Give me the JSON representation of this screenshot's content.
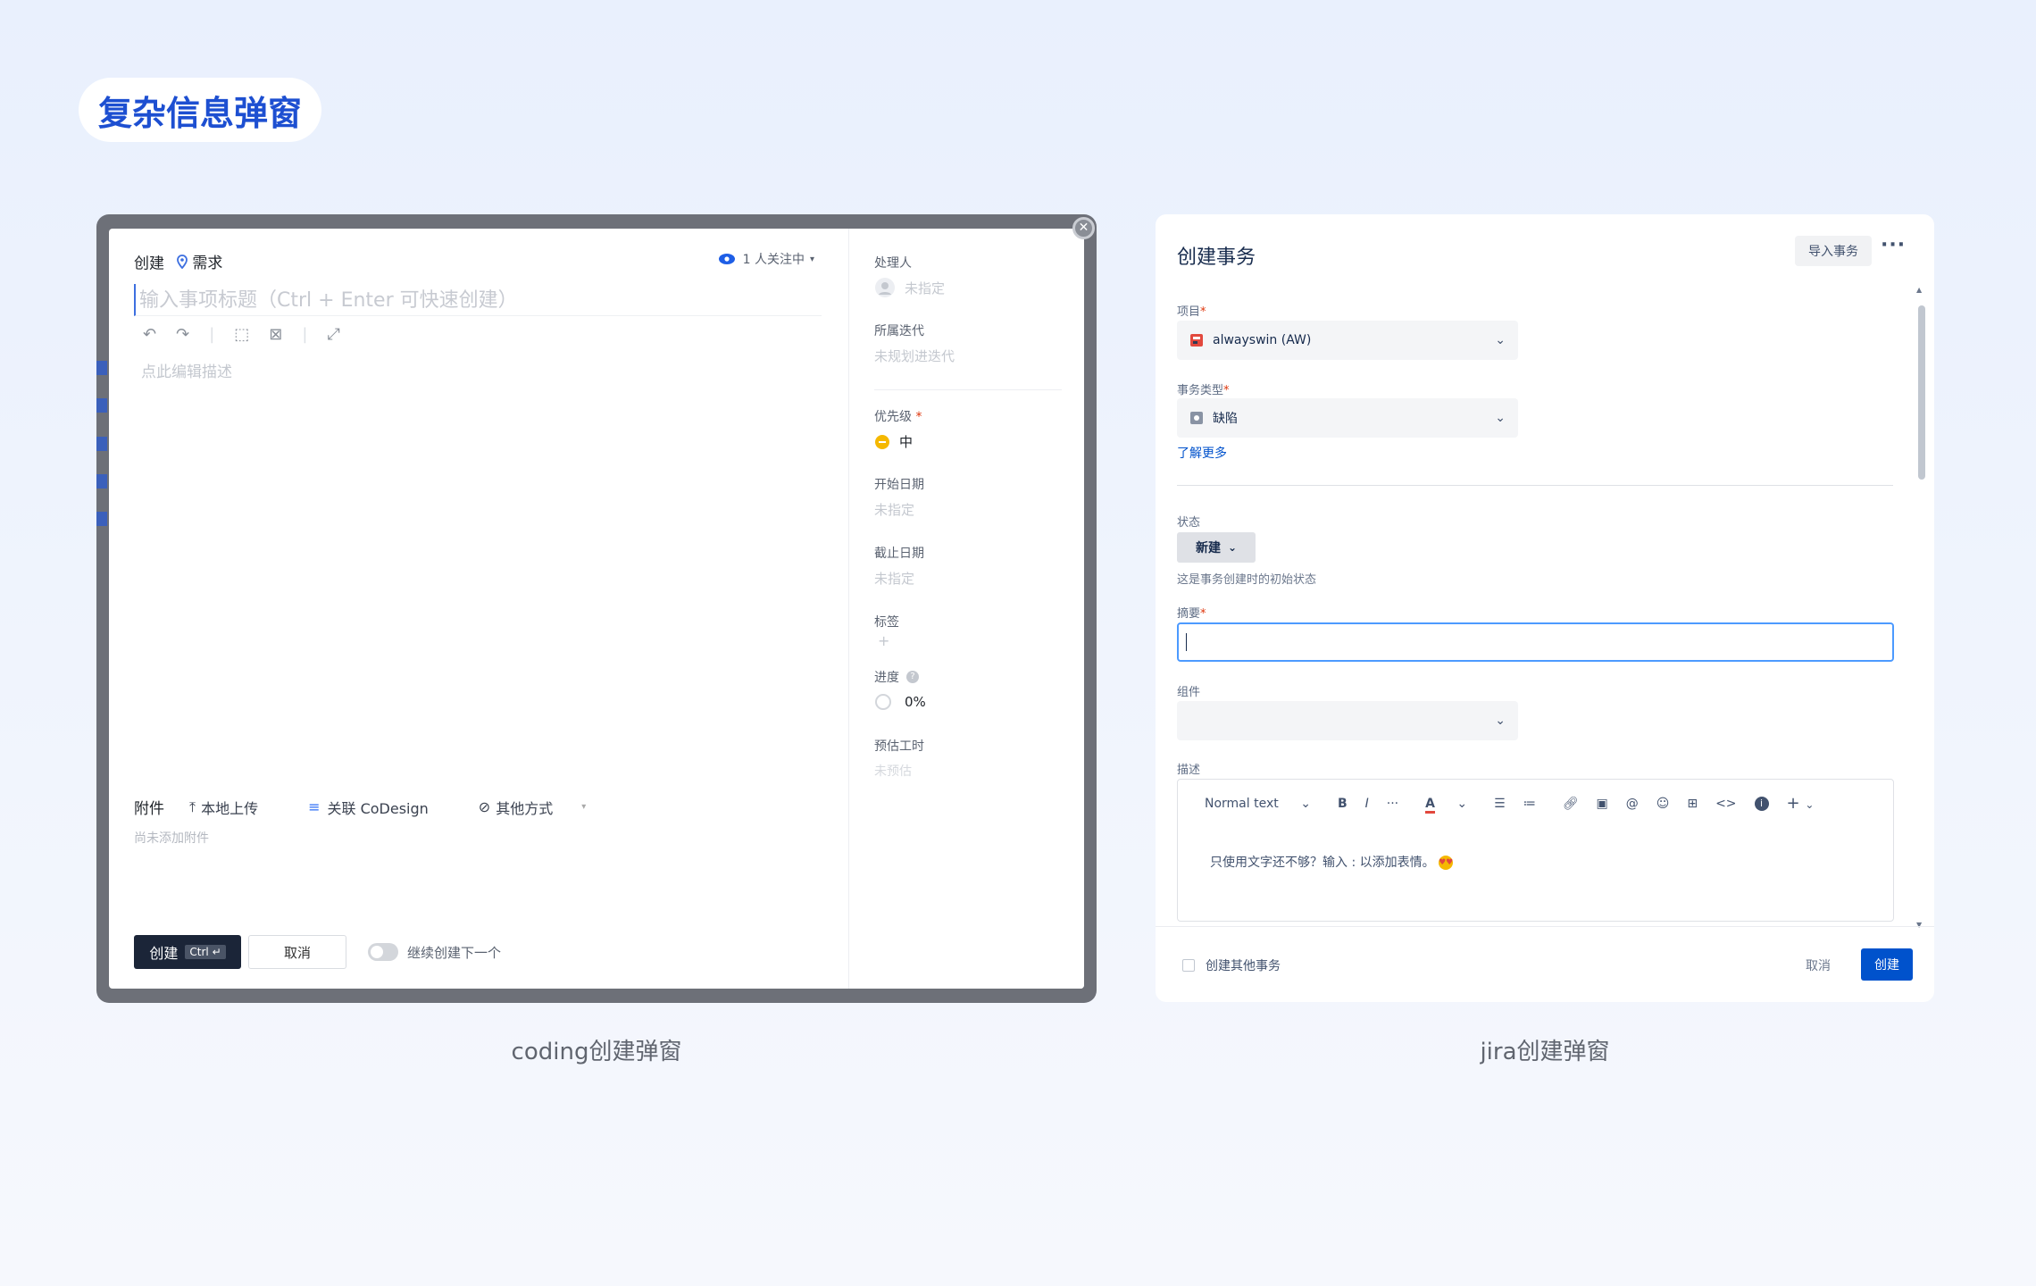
{
  "page_title": "复杂信息弹窗",
  "captions": {
    "left": "coding创建弹窗",
    "right": "jira创建弹窗"
  },
  "coding": {
    "create_label": "创建",
    "type_label": "需求",
    "watchers": "1 人关注中",
    "title_placeholder": "输入事项标题（Ctrl + Enter 可快速创建）",
    "desc_placeholder": "点此编辑描述",
    "attachments_label": "附件",
    "upload_local": "本地上传",
    "link_codesign": "关联 CoDesign",
    "other_methods": "其他方式",
    "no_attachments": "尚未添加附件",
    "create_button": "创建",
    "create_kbd": "Ctrl",
    "cancel_button": "取消",
    "continue_label": "继续创建下一个",
    "fields": {
      "assignee": {
        "label": "处理人",
        "value": "未指定"
      },
      "iteration": {
        "label": "所属迭代",
        "value": "未规划进迭代"
      },
      "priority": {
        "label": "优先级",
        "value": "中"
      },
      "start_date": {
        "label": "开始日期",
        "value": "未指定"
      },
      "due_date": {
        "label": "截止日期",
        "value": "未指定"
      },
      "tags": {
        "label": "标签",
        "value": "+"
      },
      "progress": {
        "label": "进度",
        "value": "0%"
      },
      "estimate": {
        "label": "预估工时",
        "value": "未预估"
      }
    }
  },
  "jira": {
    "title": "创建事务",
    "import_button": "导入事务",
    "more_icon": "···",
    "project_label": "项目",
    "project_value": "alwayswin (AW)",
    "issue_type_label": "事务类型",
    "issue_type_value": "缺陷",
    "learn_more": "了解更多",
    "status_label": "状态",
    "status_value": "新建",
    "status_hint": "这是事务创建时的初始状态",
    "summary_label": "摘要",
    "component_label": "组件",
    "description_label": "描述",
    "editor_text_style": "Normal text",
    "editor_placeholder": "只使用文字还不够？输入 : 以添加表情。",
    "create_other_label": "创建其他事务",
    "cancel_button": "取消",
    "create_button": "创建"
  }
}
